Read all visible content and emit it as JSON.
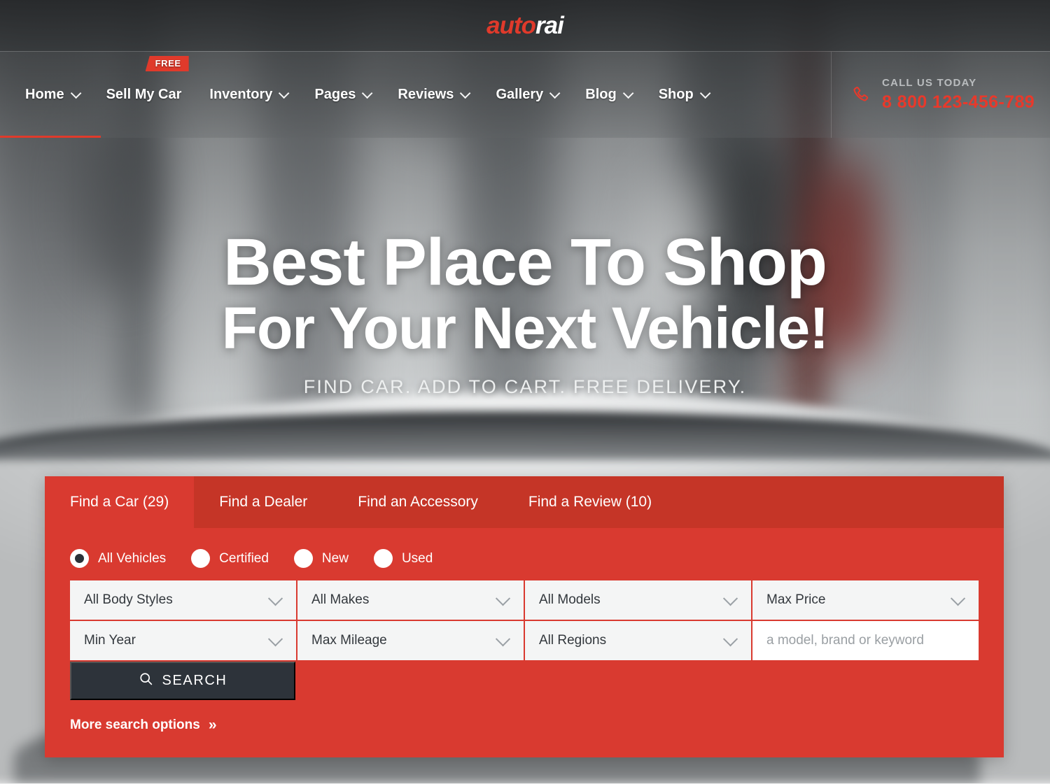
{
  "brand": {
    "name_red": "auto",
    "name_white": "rai"
  },
  "nav": {
    "items": [
      {
        "label": "Home",
        "caret": true,
        "active": true,
        "badge": null
      },
      {
        "label": "Sell My Car",
        "caret": false,
        "active": false,
        "badge": "FREE"
      },
      {
        "label": "Inventory",
        "caret": true,
        "active": false,
        "badge": null
      },
      {
        "label": "Pages",
        "caret": true,
        "active": false,
        "badge": null
      },
      {
        "label": "Reviews",
        "caret": true,
        "active": false,
        "badge": null
      },
      {
        "label": "Gallery",
        "caret": true,
        "active": false,
        "badge": null
      },
      {
        "label": "Blog",
        "caret": true,
        "active": false,
        "badge": null
      },
      {
        "label": "Shop",
        "caret": true,
        "active": false,
        "badge": null
      }
    ]
  },
  "call": {
    "label": "CALL US TODAY",
    "number": "8 800 123-456-789",
    "icon": "phone-icon"
  },
  "hero": {
    "line1": "Best Place To Shop",
    "line2": "For Your Next Vehicle!",
    "subtitle": "FIND CAR. ADD TO CART. FREE DELIVERY."
  },
  "search_panel": {
    "tabs": [
      {
        "label": "Find a Car (29)",
        "active": true
      },
      {
        "label": "Find a Dealer",
        "active": false
      },
      {
        "label": "Find an Accessory",
        "active": false
      },
      {
        "label": "Find a Review (10)",
        "active": false
      }
    ],
    "condition_options": [
      {
        "label": "All Vehicles",
        "selected": true
      },
      {
        "label": "Certified",
        "selected": false
      },
      {
        "label": "New",
        "selected": false
      },
      {
        "label": "Used",
        "selected": false
      }
    ],
    "fields": [
      {
        "name": "body-style",
        "value": "All Body Styles",
        "type": "select"
      },
      {
        "name": "make",
        "value": "All Makes",
        "type": "select"
      },
      {
        "name": "model",
        "value": "All Models",
        "type": "select"
      },
      {
        "name": "max-price",
        "value": "Max Price",
        "type": "select"
      },
      {
        "name": "min-year",
        "value": "Min Year",
        "type": "select"
      },
      {
        "name": "max-mileage",
        "value": "Max Mileage",
        "type": "select"
      },
      {
        "name": "region",
        "value": "All Regions",
        "type": "select"
      },
      {
        "name": "keyword",
        "placeholder": "a model, brand or keyword",
        "type": "text"
      }
    ],
    "search_button": {
      "label": "SEARCH",
      "icon": "search-icon"
    },
    "more_options": {
      "label": "More search options",
      "chevrons": "»"
    }
  },
  "colors": {
    "brand_red": "#e03a2b",
    "panel_red": "#d93a30",
    "tabbar_red": "#c53527",
    "button_dark": "#2d333a",
    "field_bg": "#f4f5f5"
  }
}
